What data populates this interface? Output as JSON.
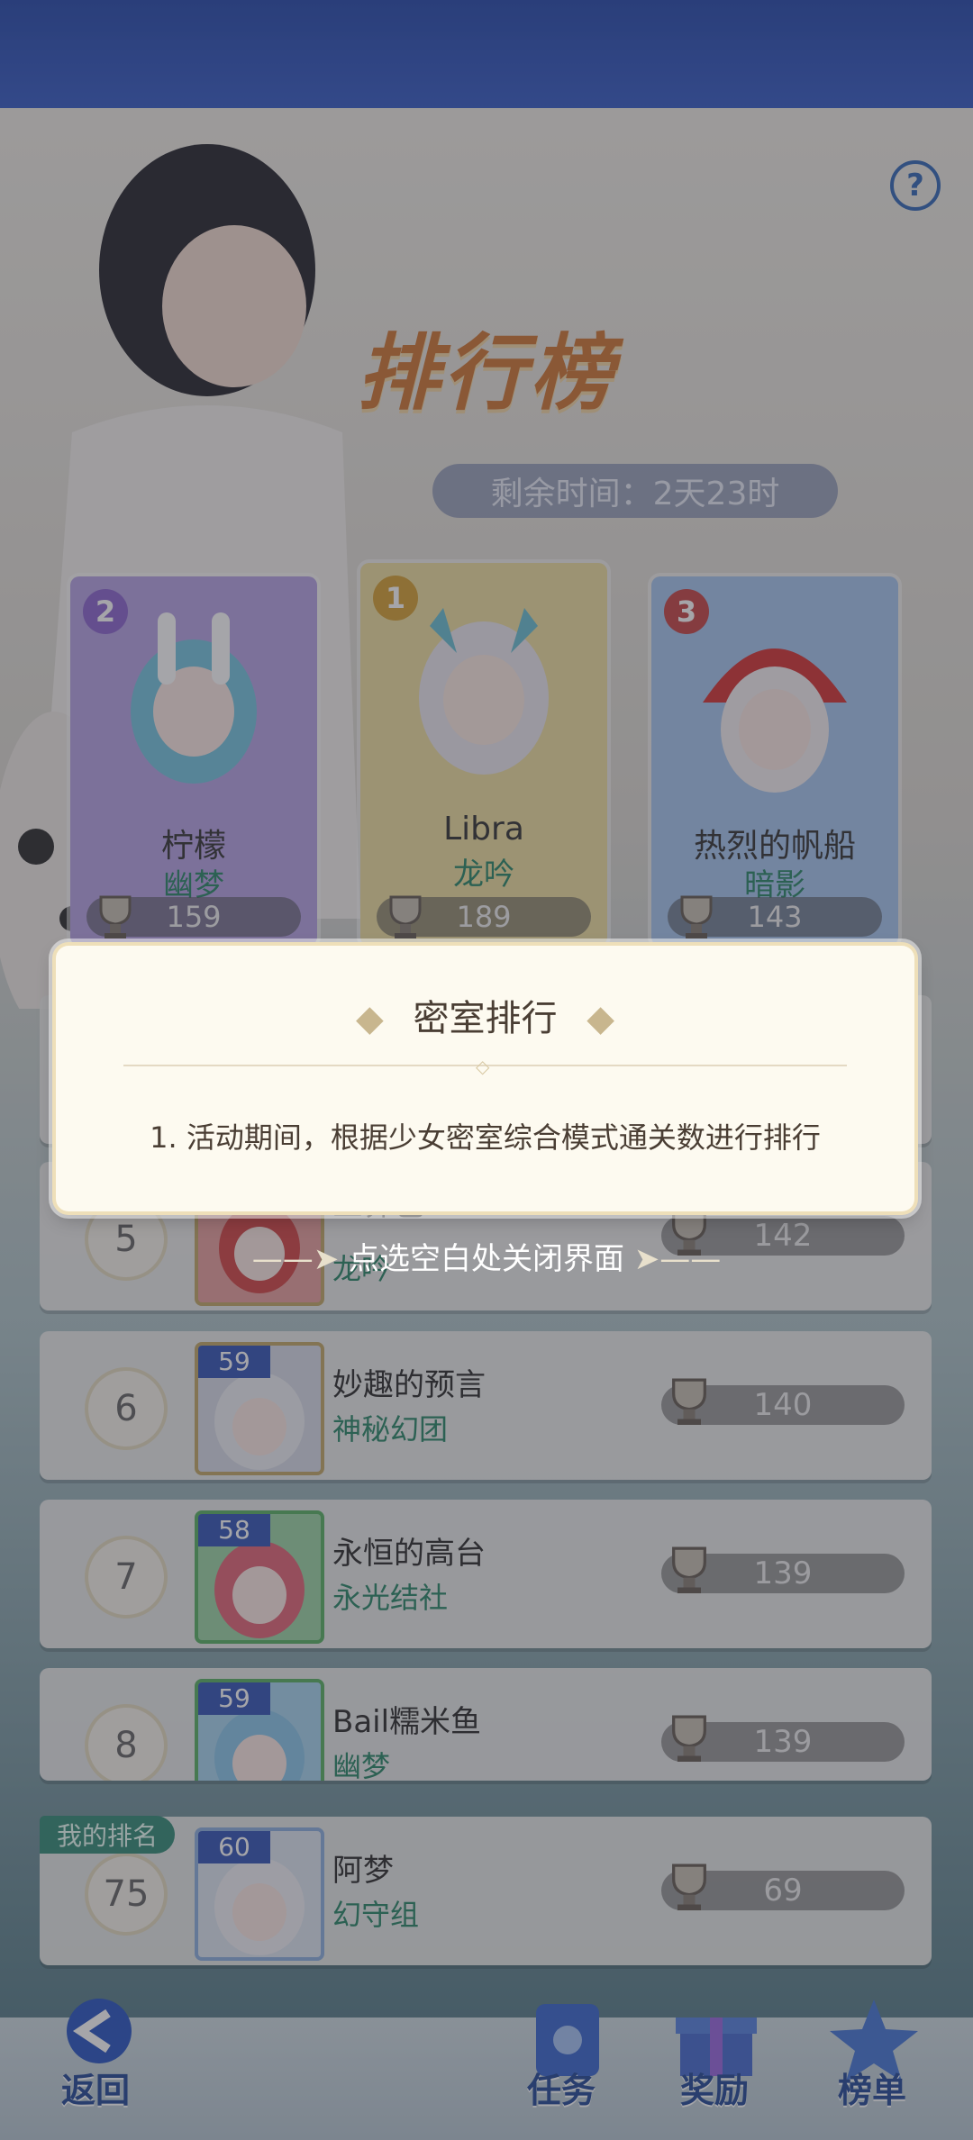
{
  "header": {
    "title": "排行榜",
    "timer_label": "剩余时间",
    "timer_value": "2天23时"
  },
  "top3": [
    {
      "rank": "2",
      "name": "柠檬",
      "guild": "幽梦",
      "score": "159",
      "color": "#b9a6e6"
    },
    {
      "rank": "1",
      "name": "Libra",
      "guild": "龙吟",
      "score": "189",
      "color": "#efe0a2"
    },
    {
      "rank": "3",
      "name": "热烈的帆船",
      "guild": "暗影",
      "score": "143",
      "color": "#a9c8f0"
    }
  ],
  "rows": [
    {
      "rank": "5",
      "level": "",
      "name": "三界色",
      "guild": "龙吟",
      "score": "142"
    },
    {
      "rank": "6",
      "level": "59",
      "name": "妙趣的预言",
      "guild": "神秘幻团",
      "score": "140"
    },
    {
      "rank": "7",
      "level": "58",
      "name": "永恒的高台",
      "guild": "永光结社",
      "score": "139"
    },
    {
      "rank": "8",
      "level": "59",
      "name": "Bail糯米鱼",
      "guild": "幽梦",
      "score": "139"
    }
  ],
  "my_rank": {
    "tag": "我的排名",
    "rank": "75",
    "level": "60",
    "name": "阿梦",
    "guild": "幻守组",
    "score": "69"
  },
  "dialog": {
    "title": "密室排行",
    "body": "1. 活动期间，根据少女密室综合模式通关数进行排行",
    "close_hint": "点选空白处关闭界面"
  },
  "nav": {
    "back": "返回",
    "tasks": "任务",
    "rewards": "奖励",
    "leaderboard": "榜单"
  }
}
